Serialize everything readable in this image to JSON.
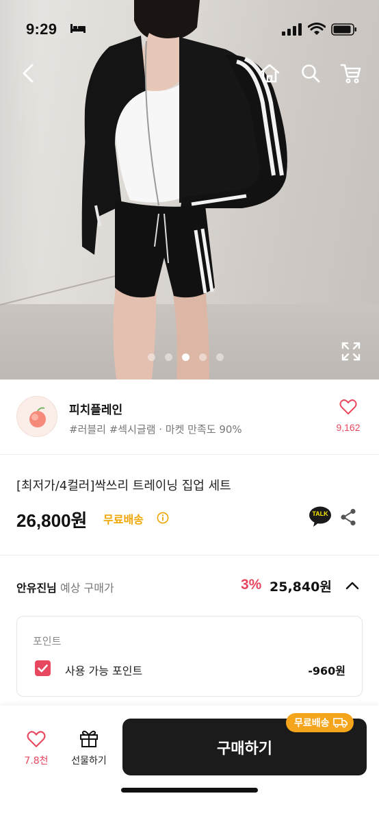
{
  "status_bar": {
    "time": "9:29",
    "icons": [
      "bed-icon",
      "signal-icon",
      "wifi-icon",
      "battery-icon"
    ]
  },
  "nav": {
    "icons": [
      "back-arrow-icon",
      "home-icon",
      "search-icon",
      "cart-icon"
    ]
  },
  "gallery": {
    "page_count": 5,
    "active_index": 3,
    "expand_icon": "expand-icon"
  },
  "store": {
    "name": "피치플레인",
    "meta": "#러블리 #섹시글램 · 마켓 만족도 90%",
    "like_count": "9,162"
  },
  "product": {
    "title": "[최저가/4컬러]싹쓰리 트레이닝 집업 세트",
    "price": "26,800원",
    "shipping": "무료배송",
    "talk_label": "TALK"
  },
  "estimate": {
    "name": "안유진님",
    "label": "예상 구매가",
    "rate": "3%",
    "price": "25,840원"
  },
  "points": {
    "title": "포인트",
    "item_label": "사용 가능 포인트",
    "item_value": "-960원",
    "checked": true
  },
  "bottom_bar": {
    "like_count": "7.8천",
    "gift_label": "선물하기",
    "buy_label": "구매하기",
    "badge_label": "무료배송"
  },
  "colors": {
    "accent_pink": "#e8485f",
    "shipping_orange": "#f0a500",
    "buy_button": "#1b1b1b"
  }
}
